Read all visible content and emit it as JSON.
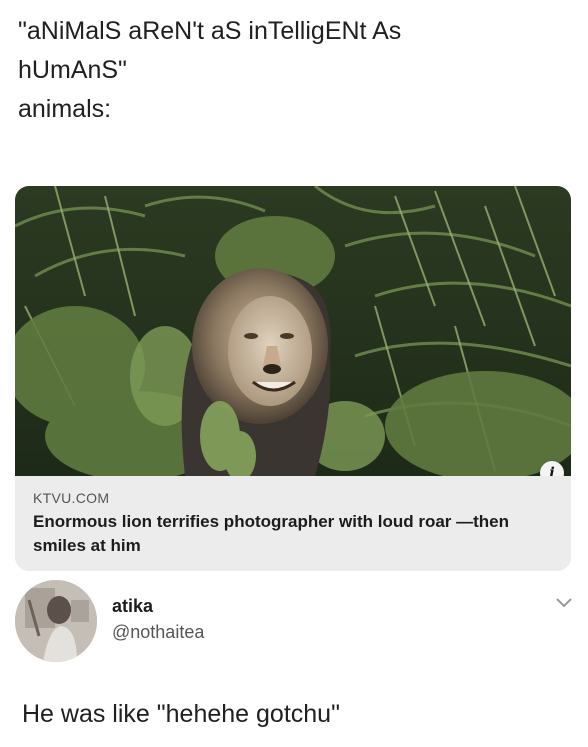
{
  "post": {
    "lines": [
      "\"aNiMalS aReN't aS inTelligENt As",
      "hUmAnS\"",
      "animals:"
    ]
  },
  "card": {
    "domain": "KTVU.COM",
    "title": "Enormous lion terrifies photographer with loud roar —then smiles at him",
    "info_icon": "info-icon"
  },
  "author": {
    "name": "atika",
    "handle": "@nothaitea",
    "menu_icon": "chevron-down-icon"
  },
  "reply": {
    "text": "He was like \"hehehe gotchu\""
  }
}
